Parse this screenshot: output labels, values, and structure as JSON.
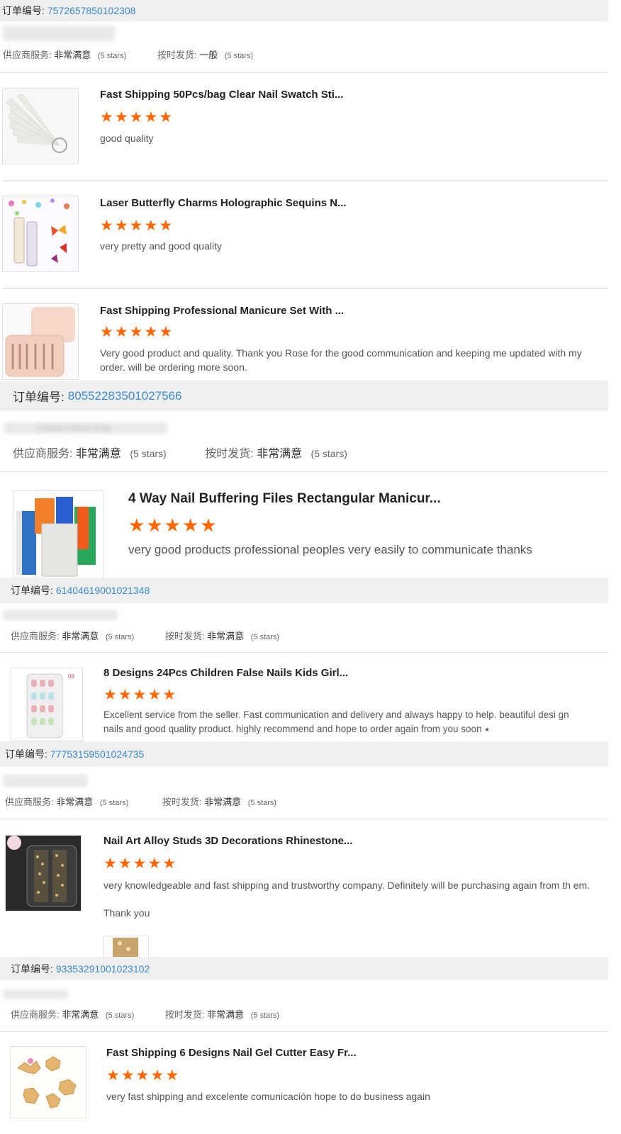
{
  "labels": {
    "order_no": "订单编号:",
    "supplier_service": "供应商服务:",
    "on_time_delivery": "按时发货:",
    "stars_note": "(5 stars)"
  },
  "colors": {
    "star": "#ff6500",
    "link": "#3a8ad0",
    "bar": "#efefef"
  },
  "star_icon": "star-icon",
  "orders": [
    {
      "order_number": "7572657850102308",
      "location": "",
      "supplier_value": "非常满意",
      "delivery_value": "一般",
      "items": [
        {
          "title": "Fast Shipping 50Pcs/bag Clear Nail Swatch Sti...",
          "rating": 5,
          "comment": "good quality"
        },
        {
          "title": "Laser Butterfly Charms Holographic Sequins N...",
          "rating": 5,
          "comment": "very pretty and good quality"
        },
        {
          "title": "Fast Shipping Professional Manicure Set With ...",
          "rating": 5,
          "comment": "Very good product and quality. Thank you Rose for the good communication and keeping me updated with my order. will be ordering more soon."
        }
      ]
    },
    {
      "order_number": "80552283501027566",
      "location": "Oviedo,United King",
      "supplier_value": "非常满意",
      "delivery_value": "非常满意",
      "items": [
        {
          "title": "4 Way Nail Buffering Files Rectangular Manicur...",
          "rating": 5,
          "comment": "very good products professional peoples very easily to communicate thanks"
        }
      ]
    },
    {
      "order_number": "61404619001021348",
      "location": "",
      "supplier_value": "非常满意",
      "delivery_value": "非常满意",
      "items": [
        {
          "title": "8 Designs 24Pcs Children False Nails Kids Girl...",
          "rating": 5,
          "comment": "Excellent service from the seller. Fast communication and delivery and always happy to help. beautiful desi gn nails and good quality product. highly recommend and hope to order again from you soon ⭑"
        }
      ]
    },
    {
      "order_number": "77753159501024735",
      "location": "",
      "supplier_value": "非常满意",
      "delivery_value": "非常满意",
      "items": [
        {
          "title": "Nail Art Alloy Studs 3D Decorations Rhinestone...",
          "rating": 5,
          "comment": "very knowledgeable and fast shipping and trustworthy company. Definitely will be purchasing again from th em.",
          "comment2": "Thank you"
        }
      ]
    },
    {
      "order_number": "93353291001023102",
      "location": "",
      "supplier_value": "非常满意",
      "delivery_value": "非常满意",
      "items": [
        {
          "title": "Fast Shipping 6 Designs Nail Gel Cutter Easy Fr...",
          "rating": 5,
          "comment": "very fast shipping and excelente comunicación hope to do business again"
        }
      ]
    }
  ]
}
